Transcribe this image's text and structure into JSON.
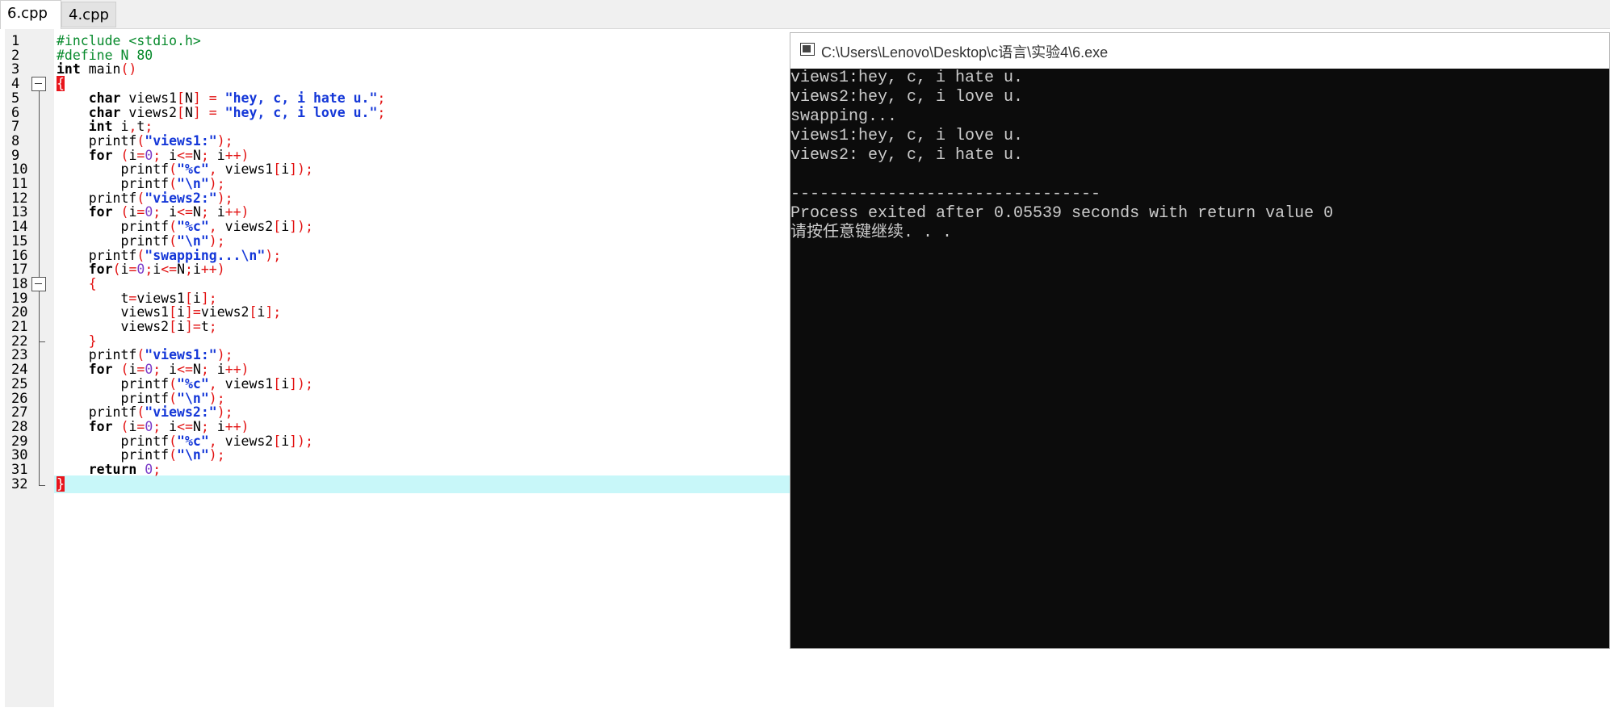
{
  "tabs": [
    {
      "label": "6.cpp",
      "active": true
    },
    {
      "label": "4.cpp",
      "active": false
    }
  ],
  "editor": {
    "current_line": 32,
    "lines": [
      {
        "n": 1,
        "tokens": [
          [
            "#include <stdio.h>",
            "pp"
          ]
        ]
      },
      {
        "n": 2,
        "tokens": [
          [
            "#define N 80",
            "pp"
          ]
        ]
      },
      {
        "n": 3,
        "tokens": [
          [
            "int",
            "kw"
          ],
          [
            " main",
            ""
          ],
          [
            "()",
            "op"
          ]
        ]
      },
      {
        "n": 4,
        "tokens": [
          [
            "{",
            "brace"
          ]
        ]
      },
      {
        "n": 5,
        "tokens": [
          [
            "    ",
            ""
          ],
          [
            "char",
            "kw"
          ],
          [
            " views1",
            ""
          ],
          [
            "[",
            "op"
          ],
          [
            "N",
            ""
          ],
          [
            "]",
            "op"
          ],
          [
            " = ",
            "op"
          ],
          [
            "\"hey, c, i hate u.\"",
            "str"
          ],
          [
            ";",
            "op"
          ]
        ]
      },
      {
        "n": 6,
        "tokens": [
          [
            "    ",
            ""
          ],
          [
            "char",
            "kw"
          ],
          [
            " views2",
            ""
          ],
          [
            "[",
            "op"
          ],
          [
            "N",
            ""
          ],
          [
            "]",
            "op"
          ],
          [
            " = ",
            "op"
          ],
          [
            "\"hey, c, i love u.\"",
            "str"
          ],
          [
            ";",
            "op"
          ]
        ]
      },
      {
        "n": 7,
        "tokens": [
          [
            "    ",
            ""
          ],
          [
            "int",
            "kw"
          ],
          [
            " i",
            ""
          ],
          [
            ",",
            "op"
          ],
          [
            "t",
            ""
          ],
          [
            ";",
            "op"
          ]
        ]
      },
      {
        "n": 8,
        "tokens": [
          [
            "    printf",
            ""
          ],
          [
            "(",
            "op"
          ],
          [
            "\"views1:\"",
            "str"
          ],
          [
            ");",
            "op"
          ]
        ]
      },
      {
        "n": 9,
        "tokens": [
          [
            "    ",
            ""
          ],
          [
            "for",
            "kw"
          ],
          [
            " ",
            ""
          ],
          [
            "(",
            "op"
          ],
          [
            "i",
            ""
          ],
          [
            "=",
            "op"
          ],
          [
            "0",
            "num"
          ],
          [
            ";",
            "op"
          ],
          [
            " i",
            ""
          ],
          [
            "<=",
            "op"
          ],
          [
            "N",
            ""
          ],
          [
            ";",
            "op"
          ],
          [
            " i",
            ""
          ],
          [
            "++)",
            "op"
          ]
        ]
      },
      {
        "n": 10,
        "tokens": [
          [
            "        printf",
            ""
          ],
          [
            "(",
            "op"
          ],
          [
            "\"%c\"",
            "str"
          ],
          [
            ",",
            "op"
          ],
          [
            " views1",
            ""
          ],
          [
            "[",
            "op"
          ],
          [
            "i",
            ""
          ],
          [
            "]);",
            "op"
          ]
        ]
      },
      {
        "n": 11,
        "tokens": [
          [
            "        printf",
            ""
          ],
          [
            "(",
            "op"
          ],
          [
            "\"\\n\"",
            "str"
          ],
          [
            ");",
            "op"
          ]
        ]
      },
      {
        "n": 12,
        "tokens": [
          [
            "    printf",
            ""
          ],
          [
            "(",
            "op"
          ],
          [
            "\"views2:\"",
            "str"
          ],
          [
            ");",
            "op"
          ]
        ]
      },
      {
        "n": 13,
        "tokens": [
          [
            "    ",
            ""
          ],
          [
            "for",
            "kw"
          ],
          [
            " ",
            ""
          ],
          [
            "(",
            "op"
          ],
          [
            "i",
            ""
          ],
          [
            "=",
            "op"
          ],
          [
            "0",
            "num"
          ],
          [
            ";",
            "op"
          ],
          [
            " i",
            ""
          ],
          [
            "<=",
            "op"
          ],
          [
            "N",
            ""
          ],
          [
            ";",
            "op"
          ],
          [
            " i",
            ""
          ],
          [
            "++)",
            "op"
          ]
        ]
      },
      {
        "n": 14,
        "tokens": [
          [
            "        printf",
            ""
          ],
          [
            "(",
            "op"
          ],
          [
            "\"%c\"",
            "str"
          ],
          [
            ",",
            "op"
          ],
          [
            " views2",
            ""
          ],
          [
            "[",
            "op"
          ],
          [
            "i",
            ""
          ],
          [
            "]);",
            "op"
          ]
        ]
      },
      {
        "n": 15,
        "tokens": [
          [
            "        printf",
            ""
          ],
          [
            "(",
            "op"
          ],
          [
            "\"\\n\"",
            "str"
          ],
          [
            ");",
            "op"
          ]
        ]
      },
      {
        "n": 16,
        "tokens": [
          [
            "    printf",
            ""
          ],
          [
            "(",
            "op"
          ],
          [
            "\"swapping...\\n\"",
            "str"
          ],
          [
            ");",
            "op"
          ]
        ]
      },
      {
        "n": 17,
        "tokens": [
          [
            "    ",
            ""
          ],
          [
            "for",
            "kw"
          ],
          [
            "(",
            "op"
          ],
          [
            "i",
            ""
          ],
          [
            "=",
            "op"
          ],
          [
            "0",
            "num"
          ],
          [
            ";",
            "op"
          ],
          [
            "i",
            ""
          ],
          [
            "<=",
            "op"
          ],
          [
            "N",
            ""
          ],
          [
            ";",
            "op"
          ],
          [
            "i",
            ""
          ],
          [
            "++)",
            "op"
          ]
        ]
      },
      {
        "n": 18,
        "tokens": [
          [
            "    ",
            ""
          ],
          [
            "{",
            "op"
          ]
        ]
      },
      {
        "n": 19,
        "tokens": [
          [
            "        t",
            ""
          ],
          [
            "=",
            "op"
          ],
          [
            "views1",
            ""
          ],
          [
            "[",
            "op"
          ],
          [
            "i",
            ""
          ],
          [
            "];",
            "op"
          ]
        ]
      },
      {
        "n": 20,
        "tokens": [
          [
            "        views1",
            ""
          ],
          [
            "[",
            "op"
          ],
          [
            "i",
            ""
          ],
          [
            "]=",
            "op"
          ],
          [
            "views2",
            ""
          ],
          [
            "[",
            "op"
          ],
          [
            "i",
            ""
          ],
          [
            "];",
            "op"
          ]
        ]
      },
      {
        "n": 21,
        "tokens": [
          [
            "        views2",
            ""
          ],
          [
            "[",
            "op"
          ],
          [
            "i",
            ""
          ],
          [
            "]=",
            "op"
          ],
          [
            "t",
            ""
          ],
          [
            ";",
            "op"
          ]
        ]
      },
      {
        "n": 22,
        "tokens": [
          [
            "    ",
            ""
          ],
          [
            "}",
            "op"
          ]
        ]
      },
      {
        "n": 23,
        "tokens": [
          [
            "    printf",
            ""
          ],
          [
            "(",
            "op"
          ],
          [
            "\"views1:\"",
            "str"
          ],
          [
            ");",
            "op"
          ]
        ]
      },
      {
        "n": 24,
        "tokens": [
          [
            "    ",
            ""
          ],
          [
            "for",
            "kw"
          ],
          [
            " ",
            ""
          ],
          [
            "(",
            "op"
          ],
          [
            "i",
            ""
          ],
          [
            "=",
            "op"
          ],
          [
            "0",
            "num"
          ],
          [
            ";",
            "op"
          ],
          [
            " i",
            ""
          ],
          [
            "<=",
            "op"
          ],
          [
            "N",
            ""
          ],
          [
            ";",
            "op"
          ],
          [
            " i",
            ""
          ],
          [
            "++)",
            "op"
          ]
        ]
      },
      {
        "n": 25,
        "tokens": [
          [
            "        printf",
            ""
          ],
          [
            "(",
            "op"
          ],
          [
            "\"%c\"",
            "str"
          ],
          [
            ",",
            "op"
          ],
          [
            " views1",
            ""
          ],
          [
            "[",
            "op"
          ],
          [
            "i",
            ""
          ],
          [
            "]);",
            "op"
          ]
        ]
      },
      {
        "n": 26,
        "tokens": [
          [
            "        printf",
            ""
          ],
          [
            "(",
            "op"
          ],
          [
            "\"\\n\"",
            "str"
          ],
          [
            ");",
            "op"
          ]
        ]
      },
      {
        "n": 27,
        "tokens": [
          [
            "    printf",
            ""
          ],
          [
            "(",
            "op"
          ],
          [
            "\"views2:\"",
            "str"
          ],
          [
            ");",
            "op"
          ]
        ]
      },
      {
        "n": 28,
        "tokens": [
          [
            "    ",
            ""
          ],
          [
            "for",
            "kw"
          ],
          [
            " ",
            ""
          ],
          [
            "(",
            "op"
          ],
          [
            "i",
            ""
          ],
          [
            "=",
            "op"
          ],
          [
            "0",
            "num"
          ],
          [
            ";",
            "op"
          ],
          [
            " i",
            ""
          ],
          [
            "<=",
            "op"
          ],
          [
            "N",
            ""
          ],
          [
            ";",
            "op"
          ],
          [
            " i",
            ""
          ],
          [
            "++)",
            "op"
          ]
        ]
      },
      {
        "n": 29,
        "tokens": [
          [
            "        printf",
            ""
          ],
          [
            "(",
            "op"
          ],
          [
            "\"%c\"",
            "str"
          ],
          [
            ",",
            "op"
          ],
          [
            " views2",
            ""
          ],
          [
            "[",
            "op"
          ],
          [
            "i",
            ""
          ],
          [
            "]);",
            "op"
          ]
        ]
      },
      {
        "n": 30,
        "tokens": [
          [
            "        printf",
            ""
          ],
          [
            "(",
            "op"
          ],
          [
            "\"\\n\"",
            "str"
          ],
          [
            ");",
            "op"
          ]
        ]
      },
      {
        "n": 31,
        "tokens": [
          [
            "    ",
            ""
          ],
          [
            "return",
            "kw"
          ],
          [
            " ",
            ""
          ],
          [
            "0",
            "num"
          ],
          [
            ";",
            "op"
          ]
        ]
      },
      {
        "n": 32,
        "tokens": [
          [
            "}",
            "brace"
          ]
        ]
      }
    ]
  },
  "console": {
    "title": "C:\\Users\\Lenovo\\Desktop\\c语言\\实验4\\6.exe",
    "output": [
      "views1:hey, c, i hate u.",
      "views2:hey, c, i love u.",
      "swapping...",
      "views1:hey, c, i love u.",
      "views2: ey, c, i hate u.",
      "",
      "--------------------------------",
      "Process exited after 0.05539 seconds with return value 0",
      "请按任意键继续. . ."
    ]
  },
  "colors": {
    "preprocessor": "#078a2c",
    "string": "#1437d8",
    "operator": "#e21212",
    "number": "#7b3cc9",
    "current_line_bg": "#c8f7f9",
    "console_bg": "#0c0c0c",
    "console_fg": "#cccccc"
  },
  "icons": {
    "console": "console-window-icon",
    "fold": "fold-collapse-icon"
  }
}
